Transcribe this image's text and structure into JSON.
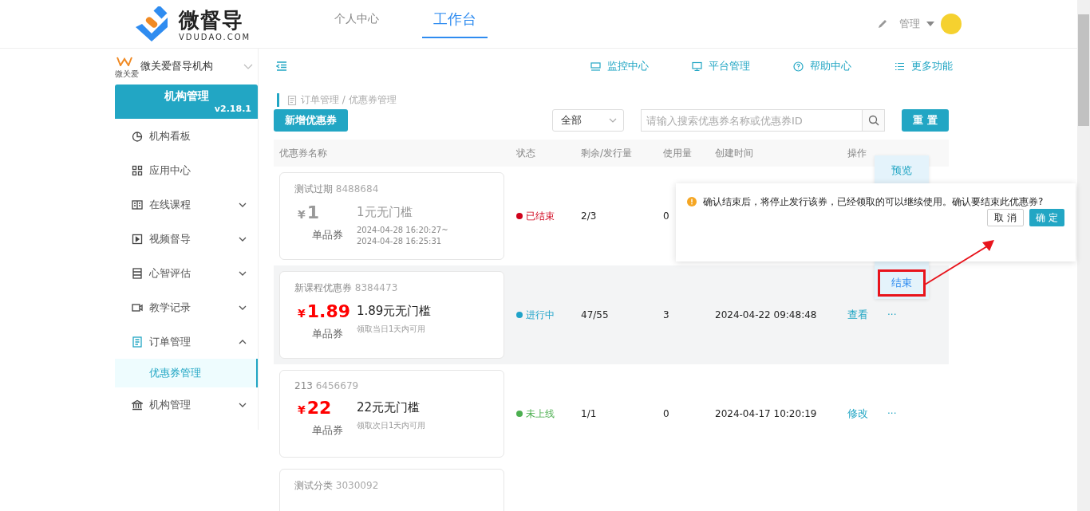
{
  "header": {
    "logo_text": "微督导",
    "logo_subtext": "VDUDAO.COM",
    "nav": [
      {
        "label": "个人中心",
        "selected": false
      },
      {
        "label": "工作台",
        "selected": true
      }
    ],
    "user_menu": "管理"
  },
  "org_select": {
    "badge": "微关爱",
    "name": "微关爱督导机构"
  },
  "toolbar_links": [
    {
      "kind": "monitor",
      "label": "监控中心"
    },
    {
      "kind": "platform",
      "label": "平台管理"
    },
    {
      "kind": "help",
      "label": "帮助中心"
    },
    {
      "kind": "more",
      "label": "更多功能"
    }
  ],
  "sidebar": {
    "title": "机构管理",
    "version": "v2.18.1",
    "items": [
      {
        "kind": "chart",
        "label": "机构看板",
        "expandable": false
      },
      {
        "kind": "grid",
        "label": "应用中心",
        "expandable": false
      },
      {
        "kind": "book",
        "label": "在线课程",
        "expandable": true,
        "expanded": false
      },
      {
        "kind": "video",
        "label": "视频督导",
        "expandable": true,
        "expanded": false
      },
      {
        "kind": "list",
        "label": "心智评估",
        "expandable": true,
        "expanded": false
      },
      {
        "kind": "camera",
        "label": "教学记录",
        "expandable": true,
        "expanded": false
      },
      {
        "kind": "order",
        "label": "订单管理",
        "expandable": true,
        "expanded": true,
        "children": [
          {
            "label": "优惠券管理",
            "selected": true
          }
        ]
      },
      {
        "kind": "bank",
        "label": "机构管理",
        "expandable": true,
        "expanded": false
      }
    ]
  },
  "breadcrumb": "订单管理 / 优惠券管理",
  "add_button": "新增优惠券",
  "filter_select": "全部",
  "search": {
    "placeholder": "请输入搜索优惠券名称或优惠券ID"
  },
  "reset_button": "重 置",
  "table": {
    "columns": [
      "优惠券名称",
      "状态",
      "剩余/发行量",
      "使用量",
      "创建时间",
      "操作"
    ],
    "rows": [
      {
        "name": "测试过期",
        "id": "8488684",
        "currency": "¥",
        "amount": "1",
        "expired": true,
        "type": "单品券",
        "title": "1元无门槛",
        "validity": [
          "2024-04-28 16:20:27~",
          "2024-04-28 16:25:31"
        ],
        "status": "已结束",
        "color": "#d0021b",
        "remain": "2/3",
        "used": "0",
        "highlighted": false
      },
      {
        "name": "新课程优惠券",
        "id": "8384473",
        "currency": "¥",
        "amount": "1.89",
        "expired": false,
        "type": "单品券",
        "title": "1.89元无门槛",
        "validity": [
          "领取当日1天内可用"
        ],
        "status": "进行中",
        "color": "#1fa3c9",
        "remain": "47/55",
        "used": "3",
        "created": "2024-04-22 09:48:48",
        "action": "查看",
        "more": "···",
        "highlighted": true
      },
      {
        "name": "213",
        "id": "6456679",
        "currency": "¥",
        "amount": "22",
        "expired": false,
        "type": "单品券",
        "title": "22元无门槛",
        "validity": [
          "领取次日1天内可用"
        ],
        "status": "未上线",
        "color": "#4caf50",
        "remain": "1/1",
        "used": "0",
        "created": "2024-04-17 10:20:19",
        "action": "修改",
        "more": "···",
        "highlighted": false
      },
      {
        "name": "测试分类",
        "id": "3030092",
        "highlighted": false
      }
    ]
  },
  "row_menu": [
    {
      "label": "预览",
      "selected": false
    },
    {
      "label": "结束",
      "selected": true
    }
  ],
  "confirm_popover": {
    "message": "确认结束后，将停止发行该券，已经领取的可以继续使用。确认要结束此优惠券?",
    "cancel": "取 消",
    "ok": "确 定"
  }
}
